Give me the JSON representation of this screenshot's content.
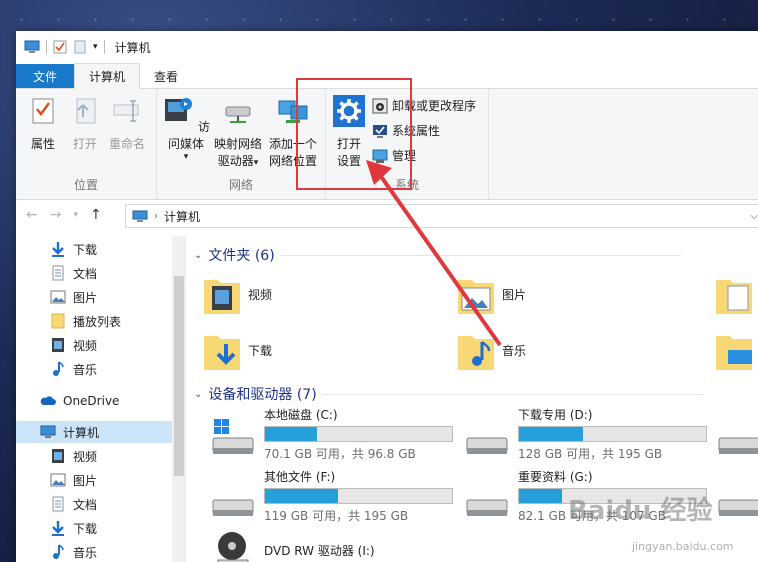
{
  "window": {
    "title": "计算机"
  },
  "tabs": [
    {
      "label": "文件"
    },
    {
      "label": "计算机"
    },
    {
      "label": "查看"
    }
  ],
  "ribbon": {
    "location_group": {
      "name": "位置",
      "properties": "属性",
      "open": "打开",
      "rename": "重命名"
    },
    "network_group": {
      "name": "网络",
      "access_media": "访问媒体",
      "map_drive_1": "映射网络",
      "map_drive_2": "驱动器",
      "add_location_1": "添加一个",
      "add_location_2": "网络位置"
    },
    "system_group": {
      "name": "系统",
      "open_settings_1": "打开",
      "open_settings_2": "设置",
      "uninstall": "卸载或更改程序",
      "system_properties": "系统属性",
      "manage": "管理"
    }
  },
  "address": {
    "path": "计算机"
  },
  "nav": {
    "items": [
      {
        "label": "下载"
      },
      {
        "label": "文档"
      },
      {
        "label": "图片"
      },
      {
        "label": "播放列表"
      },
      {
        "label": "视频"
      },
      {
        "label": "音乐"
      },
      {
        "label": "OneDrive"
      },
      {
        "label": "计算机"
      },
      {
        "label": "视频"
      },
      {
        "label": "图片"
      },
      {
        "label": "文档"
      },
      {
        "label": "下载"
      },
      {
        "label": "音乐"
      }
    ]
  },
  "folders": {
    "header": "文件夹 (6)",
    "items": [
      {
        "label": "视频"
      },
      {
        "label": "图片"
      },
      {
        "label": "下载"
      },
      {
        "label": "音乐"
      }
    ]
  },
  "drives": {
    "header": "设备和驱动器 (7)",
    "items": [
      {
        "name": "本地磁盘 (C:)",
        "free": "70.1 GB 可用，共 96.8 GB",
        "used_fraction": 0.28
      },
      {
        "name": "下载专用 (D:)",
        "free": "128 GB 可用，共 195 GB",
        "used_fraction": 0.34
      },
      {
        "name": "其他文件 (F:)",
        "free": "119 GB 可用，共 195 GB",
        "used_fraction": 0.39
      },
      {
        "name": "重要资料 (G:)",
        "free": "82.1 GB 可用，共 107 GB",
        "used_fraction": 0.23
      },
      {
        "name": "DVD RW 驱动器 (I:)"
      }
    ]
  },
  "watermark": {
    "brand": "Baidu 经验",
    "url": "jingyan.baidu.com"
  },
  "colors": {
    "accent": "#1979ca",
    "bar_fill": "#26a0da",
    "annotation": "#e0383c",
    "section_header": "#1e3287"
  }
}
